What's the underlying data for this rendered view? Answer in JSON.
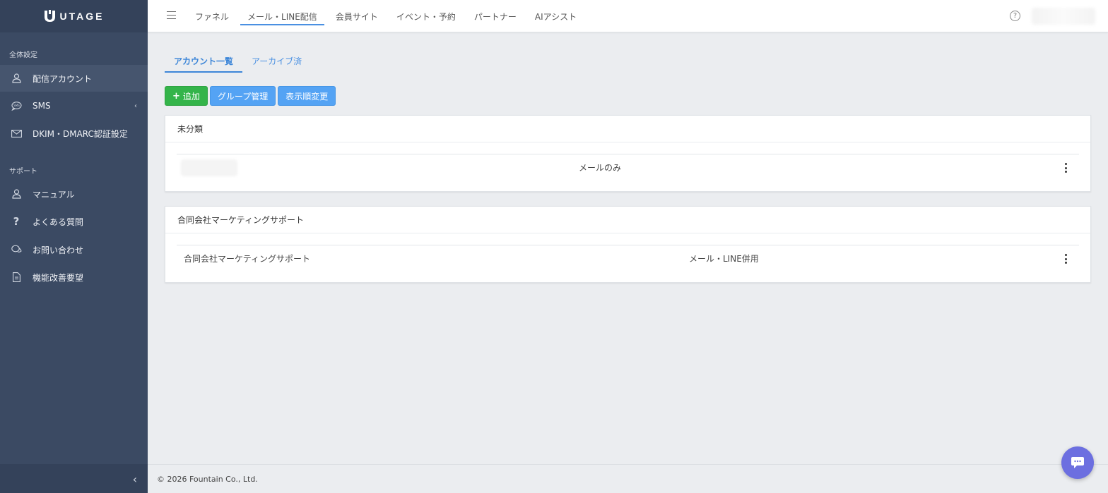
{
  "app": {
    "logo_text": "UTAGE"
  },
  "sidebar": {
    "section1_title": "全体設定",
    "section2_title": "サポート",
    "items": [
      {
        "label": "配信アカウント",
        "icon": "user-icon",
        "active": true
      },
      {
        "label": "SMS",
        "icon": "sms-icon",
        "active": false
      },
      {
        "label": "DKIM・DMARC認証設定",
        "icon": "envelope-icon",
        "active": false
      },
      {
        "label": "マニュアル",
        "icon": "user-icon",
        "active": false
      },
      {
        "label": "よくある質問",
        "icon": "question-icon",
        "active": false
      },
      {
        "label": "お問い合わせ",
        "icon": "chat-icon",
        "active": false
      },
      {
        "label": "機能改善要望",
        "icon": "document-icon",
        "active": false
      }
    ]
  },
  "topnav": {
    "items": [
      "ファネル",
      "メール・LINE配信",
      "会員サイト",
      "イベント・予約",
      "パートナー",
      "AIアシスト"
    ],
    "active_index": 1
  },
  "tabs": [
    "アカウント一覧",
    "アーカイブ済"
  ],
  "buttons": {
    "add": "追加",
    "group": "グループ管理",
    "order": "表示順変更"
  },
  "groups": [
    {
      "title": "未分類",
      "rows": [
        {
          "name": "",
          "type": "メールのみ"
        }
      ]
    },
    {
      "title": "合同会社マーケティングサポート",
      "rows": [
        {
          "name": "合同会社マーケティングサポート",
          "type": "メール・LINE併用"
        }
      ]
    }
  ],
  "footer": {
    "copyright": "© 2026 Fountain Co., Ltd."
  },
  "colors": {
    "sidebar": "#3b4a63",
    "accent": "#4a90e2",
    "green": "#34b44a",
    "chat": "#6c6fe0"
  }
}
